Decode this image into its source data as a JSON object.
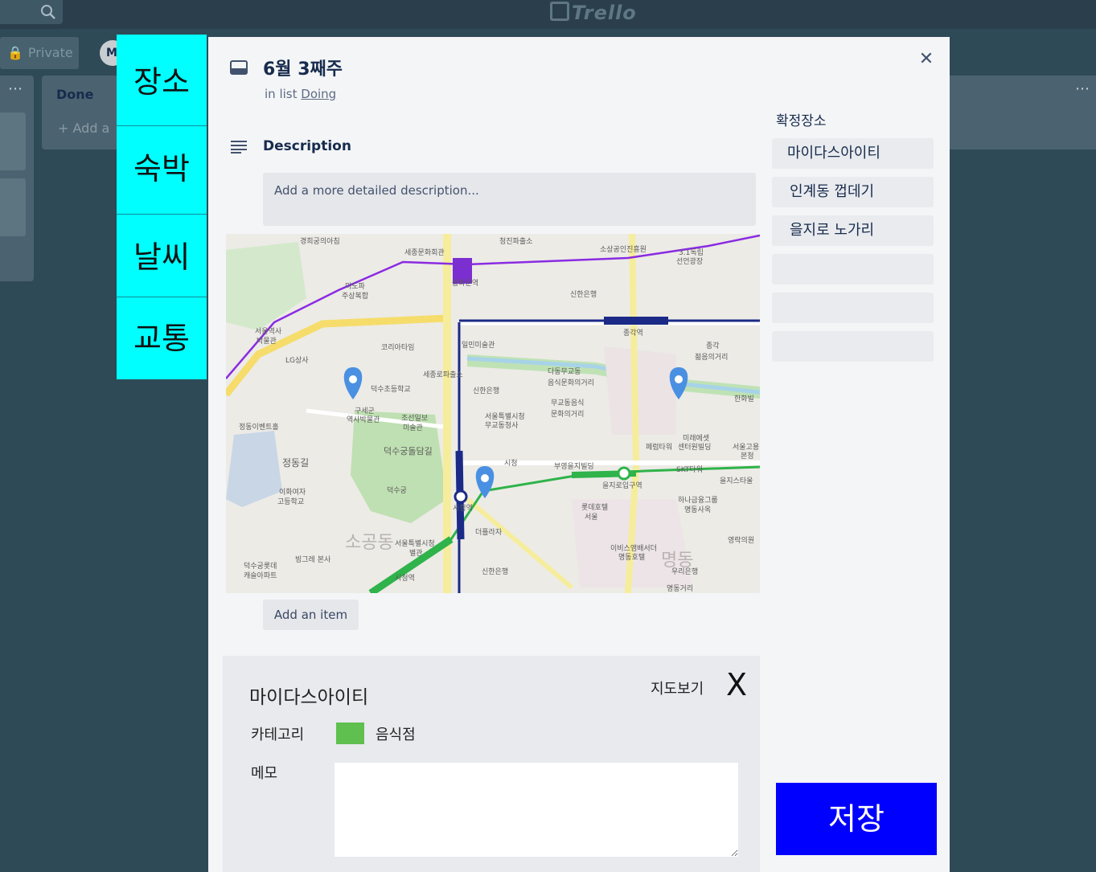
{
  "board": {
    "app_name": "Trello",
    "visibility": "Private",
    "member_initial": "M",
    "done_list_title": "Done",
    "add_card_label": "+ Add a"
  },
  "side_tabs": [
    "장소",
    "숙박",
    "날씨",
    "교통"
  ],
  "card": {
    "title": "6월 3째주",
    "in_list_prefix": "in list",
    "list_name": "Doing",
    "description_heading": "Description",
    "description_placeholder": "Add a more detailed description...",
    "add_item_label": "Add an item"
  },
  "confirmed_places": {
    "heading": "확정장소",
    "items": [
      "마이다스아이티",
      "인계동 껍데기",
      "을지로 노가리",
      "",
      "",
      ""
    ]
  },
  "map": {
    "labels": [
      "경희궁의아침",
      "세종문화회관",
      "청진파출소",
      "소상공인진흥원",
      "3.1독립",
      "선언광장",
      "미도파",
      "주상복합",
      "광화문역",
      "신한은행",
      "종각역",
      "서울역사",
      "박물관",
      "코리아타임",
      "일민미술관",
      "LG상사",
      "세종로파출소",
      "신한은행",
      "다동무교동",
      "음식문화의거리",
      "무교동음식",
      "문화의거리",
      "종각",
      "젊음의거리",
      "한화빌",
      "덕수초등학교",
      "구세군",
      "역사박물관",
      "조선일보",
      "미술관",
      "서울특별시청",
      "무교동청사",
      "정동이벤트홀",
      "덕수궁돌담길",
      "정동길",
      "이화여자",
      "고등학교",
      "덕수궁",
      "시청역",
      "시청",
      "부영을지빌딩",
      "을지로입구역",
      "SKT타워",
      "을지스타울",
      "롯데호텔",
      "서울",
      "하나금융그룹",
      "명동사옥",
      "소공동",
      "서울특별시청",
      "별관",
      "더플라자",
      "빙그레 본사",
      "덕수궁롯데",
      "캐슬아파트",
      "시청역",
      "이비스앰배서더",
      "명동호텔",
      "명동",
      "우리은행",
      "명동거리",
      "영락의원",
      "신한은행",
      "페럼타워",
      "미래에셋",
      "센터원빌딩",
      "서울고용",
      "본청"
    ]
  },
  "detail": {
    "name": "마이다스아이티",
    "map_link": "지도보기",
    "close": "X",
    "category_label": "카테고리",
    "category_value": "음식점",
    "category_color": "#5fbf4f",
    "memo_label": "메모",
    "memo_value": ""
  },
  "save_label": "저장",
  "colors": {
    "tab_bg": "#00ffff",
    "save_bg": "#0000ff",
    "pin": "#4a90e2",
    "line_purple": "#8a2be2",
    "line_navy": "#1b2a87",
    "line_green": "#2fb34a"
  }
}
